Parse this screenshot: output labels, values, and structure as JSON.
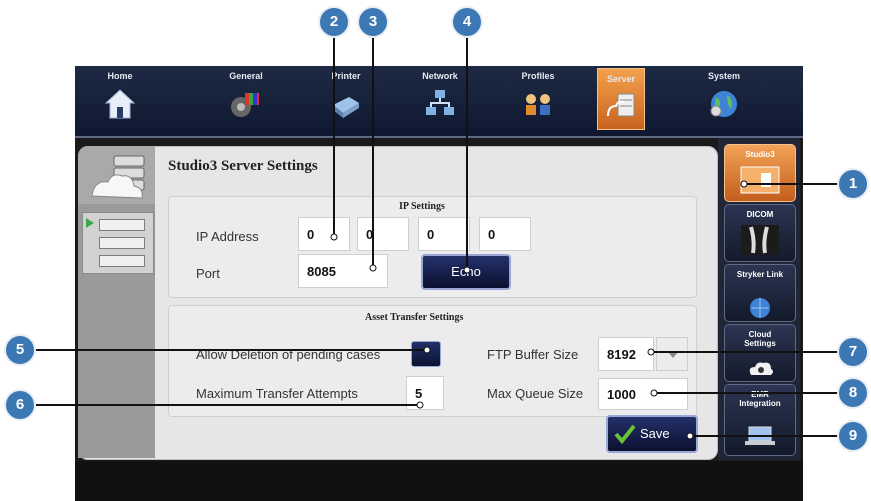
{
  "topnav": {
    "tabs": [
      {
        "label": "Home",
        "icon": "home-icon"
      },
      {
        "label": "General",
        "icon": "general-icon"
      },
      {
        "label": "Printer",
        "icon": "printer-icon"
      },
      {
        "label": "Network",
        "icon": "network-icon"
      },
      {
        "label": "Profiles",
        "icon": "profiles-icon"
      },
      {
        "label": "Server",
        "icon": "server-icon",
        "active": true
      },
      {
        "label": "System",
        "icon": "system-globe-icon"
      }
    ]
  },
  "page_title": "Studio3 Server Settings",
  "ip_settings": {
    "title": "IP Settings",
    "ip_label": "IP Address",
    "ip_octets": [
      "0",
      "0",
      "0",
      "0"
    ],
    "port_label": "Port",
    "port_value": "8085",
    "echo_label": "Echo"
  },
  "asset_transfer": {
    "title": "Asset Transfer Settings",
    "allow_deletion_label": "Allow Deletion of pending cases",
    "max_attempts_label": "Maximum Transfer Attempts",
    "max_attempts_value": "5",
    "ftp_label": "FTP Buffer Size",
    "ftp_value": "8192",
    "queue_label": "Max Queue Size",
    "queue_value": "1000"
  },
  "save_label": "Save",
  "sidebar": {
    "items": [
      {
        "label": "Studio3",
        "active": true
      },
      {
        "label": "DICOM"
      },
      {
        "label": "Stryker Link"
      },
      {
        "label": "Cloud Settings"
      },
      {
        "label": "EMR Integration"
      }
    ]
  },
  "callouts": [
    "1",
    "2",
    "3",
    "4",
    "5",
    "6",
    "7",
    "8",
    "9"
  ],
  "colors": {
    "accent_orange": "#e0823a",
    "nav_dark": "#0f1830",
    "callout_blue": "#3c78b4"
  }
}
